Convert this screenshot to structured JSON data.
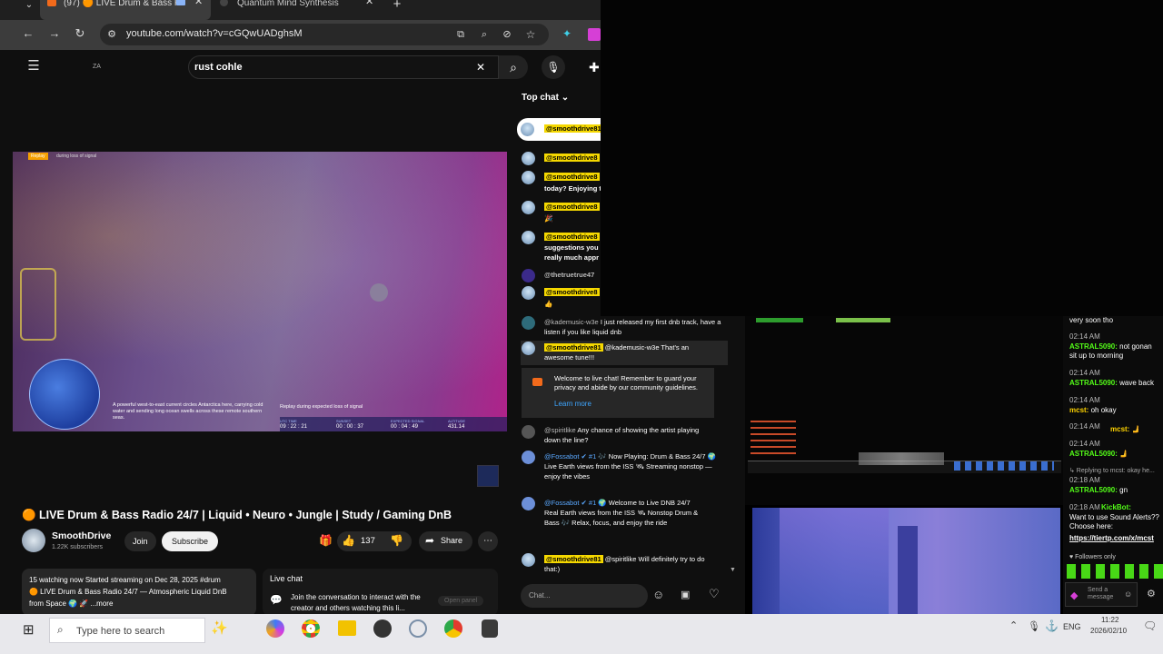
{
  "browser": {
    "tabs": [
      {
        "label": "(97) 🟠 LIVE Drum & Bass F",
        "active": true
      },
      {
        "label": "Quantum Mind Synthesis",
        "active": false
      }
    ],
    "url": "youtube.com/watch?v=cGQwUADghsM"
  },
  "youtube": {
    "country": "ZA",
    "search_value": "rust cohle",
    "video": {
      "replay_badge": "Replay",
      "top_caption": "during loss of signal",
      "caption_left": "A powerful west-to-east current circles Antarctica here, carrying cold water and sending long ocean swells across these remote southern seas.",
      "caption_right": "Replay during expected loss of signal",
      "stats": [
        {
          "label": "UTC TIME",
          "value": "09 : 22 : 21"
        },
        {
          "label": "SUNSET",
          "value": "00 : 00 : 37"
        },
        {
          "label": "EXPECTED SIGNAL",
          "value": "00 : 04 : 49"
        },
        {
          "label": "ALTITUDE",
          "value": "431.14"
        }
      ]
    },
    "title": "🟠 LIVE Drum & Bass Radio 24/7 | Liquid • Neuro • Jungle | Study / Gaming DnB",
    "channel": "SmoothDrive",
    "subscribers": "1.22K subscribers",
    "join_label": "Join",
    "subscribe_label": "Subscribe",
    "likes": "137",
    "share_label": "Share",
    "desc_line1": "15 watching now  Started streaming on Dec 28, 2025  #drum",
    "desc_line2": "🟠 LIVE Drum & Bass Radio 24/7 — Atmospheric Liquid DnB",
    "desc_line3": "from Space 🌍 🚀 ...more",
    "live_chat_label": "Live chat",
    "live_chat_text": "Join the conversation to interact with the creator and others watching this li...",
    "open_panel": "Open panel"
  },
  "chat": {
    "header": "Top chat ⌄",
    "pinned_user": "@smoothdrive81",
    "messages": [
      {
        "user": "@smoothdrive8",
        "text": ""
      },
      {
        "user": "@smoothdrive8",
        "text": "today? Enjoying t"
      },
      {
        "user": "@smoothdrive8",
        "text": "🎉"
      },
      {
        "user": "@smoothdrive8",
        "text": "suggestions you really much appr"
      },
      {
        "user": "@thetruetrue47",
        "text": ""
      },
      {
        "user": "@smoothdrive8",
        "text": "👍"
      },
      {
        "user": "@kademusic-w3e",
        "text": "I just released my first dnb track, have a listen if you like liquid dnb"
      },
      {
        "user": "@smoothdrive81",
        "text": "@kademusic-w3e That's an awesome tune!!!"
      }
    ],
    "welcome": "Welcome to live chat! Remember to guard your privacy and abide by our community guidelines.",
    "learn_more": "Learn more",
    "messages2": [
      {
        "user": "@spiritlike",
        "text": "Any chance of showing the artist playing down the line?"
      },
      {
        "user": "@Fossabot ✔ #1",
        "text": "🎶 Now Playing: Drum & Bass 24/7 🌍 Live Earth views from the ISS 🛰 Streaming nonstop — enjoy the vibes"
      },
      {
        "user": "@Fossabot ✔ #1",
        "text": "🌍 Welcome to Live DNB 24/7 Real Earth views from the ISS 🛰 Nonstop Drum & Bass 🎶 Relax, focus, and enjoy the ride"
      },
      {
        "user": "@smoothdrive81",
        "text": "@spiritlike Will definitely try to do that:)"
      }
    ],
    "input_placeholder": "Chat..."
  },
  "kick": {
    "lines": [
      {
        "time": "",
        "user": "",
        "text": "very soon tho"
      },
      {
        "time": "02:14 AM",
        "user": "ASTRAL5090:",
        "text": "not gonan sit up to morning"
      },
      {
        "time": "02:14 AM",
        "user": "ASTRAL5090:",
        "text": "wave back"
      },
      {
        "time": "02:14 AM",
        "user": "mcst:",
        "text": "oh okay"
      },
      {
        "time": "02:14 AM",
        "user": "mcst:",
        "text": "🫸"
      },
      {
        "time": "02:14 AM",
        "user": "ASTRAL5090:",
        "text": "🫸"
      },
      {
        "time": "",
        "user": "↳ Replying to mcst:",
        "text": "okay he..."
      },
      {
        "time": "02:18 AM",
        "user": "ASTRAL5090:",
        "text": "gn"
      },
      {
        "time": "02:18 AM",
        "user": "KickBot:",
        "text": "Want to use Sound Alerts?? Choose here:"
      },
      {
        "time": "",
        "user": "",
        "text": "https://tiertp.com/x/mcst"
      }
    ],
    "followers_only": "♥ Followers only",
    "send_placeholder": "Send a message"
  },
  "taskbar": {
    "search_placeholder": "Type here to search",
    "lang": "ENG",
    "time": "11:22",
    "date": "2026/02/10"
  }
}
